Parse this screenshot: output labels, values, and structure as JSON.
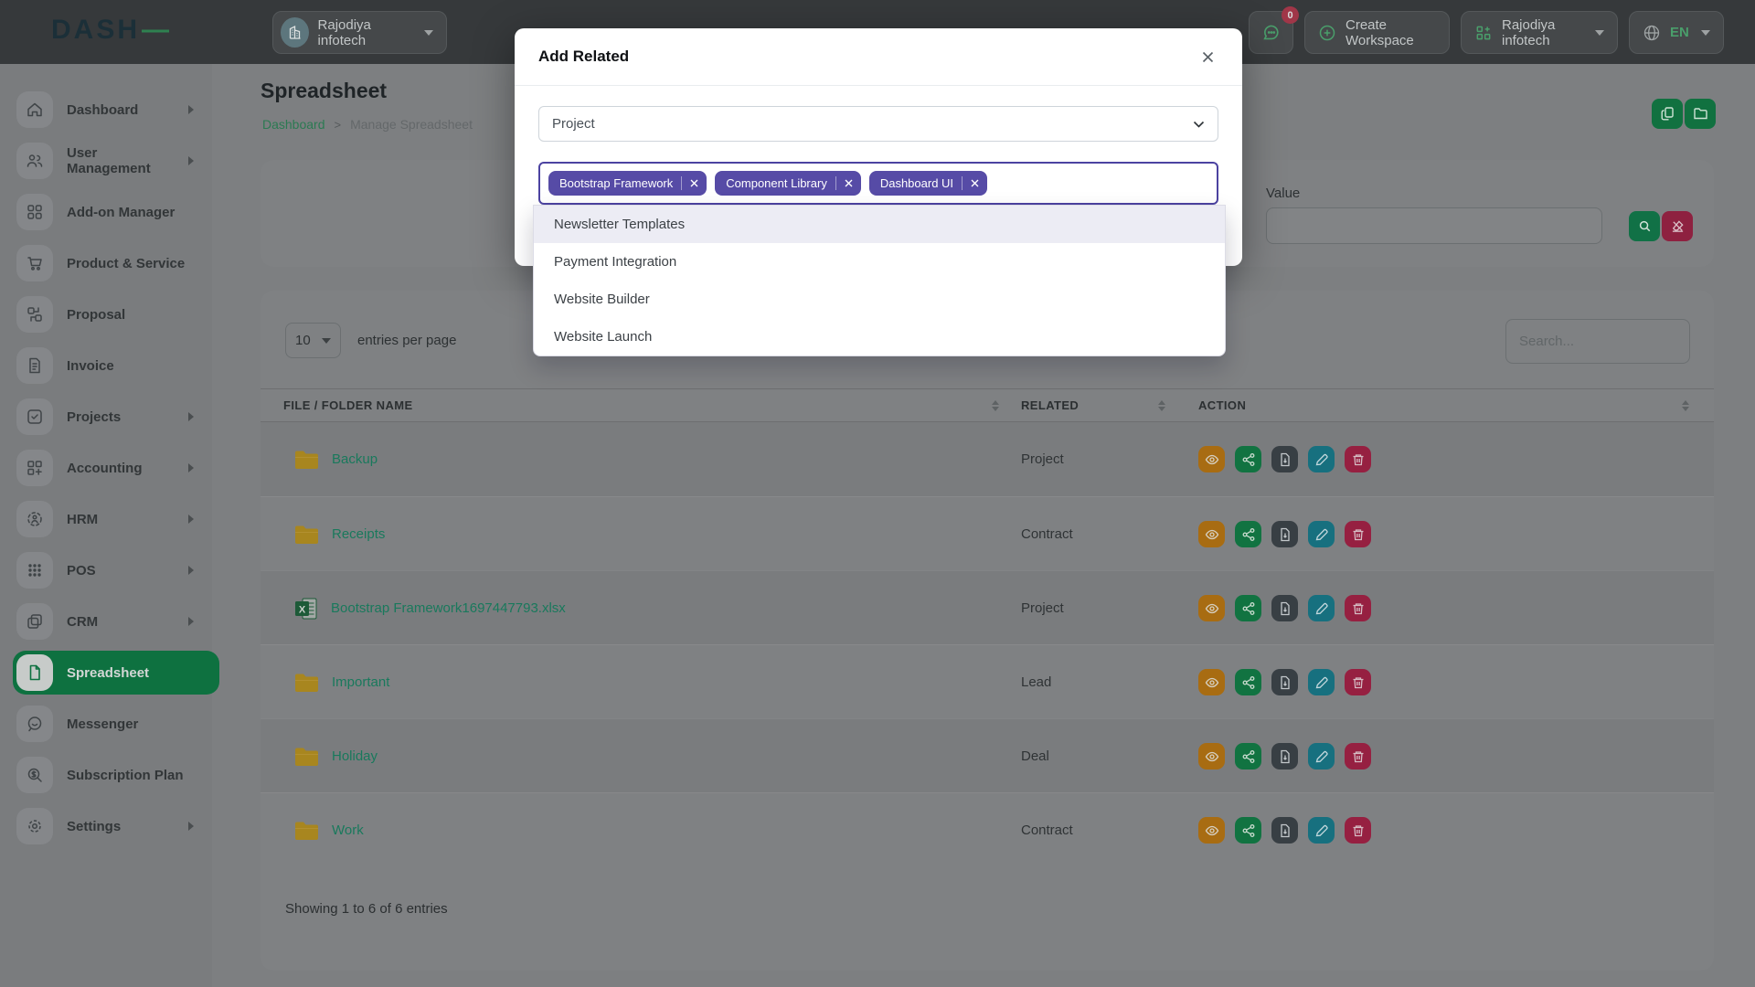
{
  "header": {
    "logo_text": "DASH",
    "logo_accent": "—",
    "workspace_switcher_label": "Rajodiya infotech",
    "messages_badge": "0",
    "create_workspace_label": "Create Workspace",
    "company_menu_label": "Rajodiya infotech",
    "language_code": "EN"
  },
  "sidebar": {
    "items": [
      {
        "label": "Dashboard"
      },
      {
        "label": "User Management"
      },
      {
        "label": "Add-on Manager"
      },
      {
        "label": "Product & Service"
      },
      {
        "label": "Proposal"
      },
      {
        "label": "Invoice"
      },
      {
        "label": "Projects"
      },
      {
        "label": "Accounting"
      },
      {
        "label": "HRM"
      },
      {
        "label": "POS"
      },
      {
        "label": "CRM"
      },
      {
        "label": "Spreadsheet"
      },
      {
        "label": "Messenger"
      },
      {
        "label": "Subscription Plan"
      },
      {
        "label": "Settings"
      }
    ]
  },
  "page": {
    "title": "Spreadsheet",
    "breadcrumb_home": "Dashboard",
    "breadcrumb_separator": ">",
    "breadcrumb_current": "Manage Spreadsheet"
  },
  "filter": {
    "value_label": "Value"
  },
  "table": {
    "entries_value": "10",
    "entries_label": "entries per page",
    "search_placeholder": "Search...",
    "columns": [
      "FILE / FOLDER NAME",
      "RELATED",
      "ACTION"
    ],
    "rows": [
      {
        "name": "Backup",
        "type": "folder",
        "related": "Project"
      },
      {
        "name": "Receipts",
        "type": "folder",
        "related": "Contract"
      },
      {
        "name": "Bootstrap Framework1697447793.xlsx",
        "type": "xlsx",
        "related": "Project"
      },
      {
        "name": "Important",
        "type": "folder",
        "related": "Lead"
      },
      {
        "name": "Holiday",
        "type": "folder",
        "related": "Deal"
      },
      {
        "name": "Work",
        "type": "folder",
        "related": "Contract"
      }
    ],
    "footer": "Showing 1 to 6 of 6 entries"
  },
  "modal": {
    "title": "Add Related",
    "type_select_value": "Project",
    "tags": [
      "Bootstrap Framework",
      "Component Library",
      "Dashboard UI"
    ],
    "options": [
      "Newsletter Templates",
      "Payment Integration",
      "Website Builder",
      "Website Launch"
    ]
  },
  "colors": {
    "sidebar_active_green": "#0e7140",
    "file_link_teal": "#19795c",
    "folder_gold": "#a8861f",
    "tag_indigo": "#564ba6",
    "tag_field_border": "#4c43a1",
    "option_highlight": "#ececf4",
    "action_view_orange": "#a86c12",
    "action_share_green": "#117341",
    "action_file_dark": "#383f44",
    "action_edit_teal": "#17707f",
    "action_delete_red": "#962041",
    "badge_red": "#a03648"
  }
}
